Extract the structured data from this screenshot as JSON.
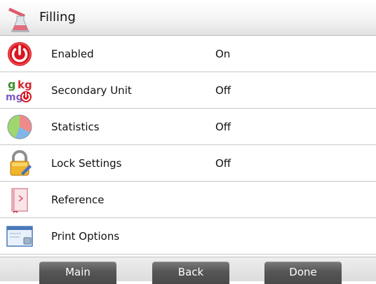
{
  "header": {
    "title": "Filling",
    "icon": "filling-beaker-icon"
  },
  "rows": [
    {
      "label": "Enabled",
      "value": "On",
      "icon": "power-icon"
    },
    {
      "label": "Secondary Unit",
      "value": "Off",
      "icon": "units-icon"
    },
    {
      "label": "Statistics",
      "value": "Off",
      "icon": "statistics-pie-icon"
    },
    {
      "label": "Lock Settings",
      "value": "Off",
      "icon": "lock-icon"
    },
    {
      "label": "Reference",
      "value": "",
      "icon": "reference-book-icon"
    },
    {
      "label": "Print Options",
      "value": "",
      "icon": "print-options-icon"
    }
  ],
  "footer": {
    "main_label": "Main",
    "back_label": "Back",
    "done_label": "Done"
  },
  "icon_text": {
    "units_g": "g",
    "units_kg": "kg",
    "units_mg": "mg"
  },
  "colors": {
    "button": "#565656",
    "power_red": "#d9161f",
    "divider": "#c8c8c8"
  }
}
